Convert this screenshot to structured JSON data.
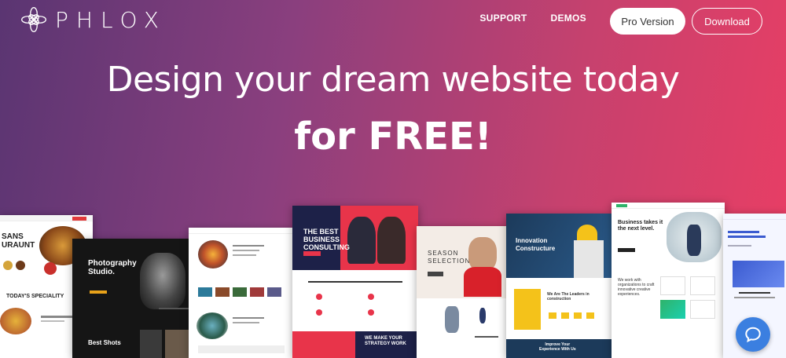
{
  "header": {
    "logo_text": "PHLOX",
    "nav": [
      "SUPPORT",
      "DEMOS"
    ],
    "pro_button": "Pro Version",
    "download_button": "Download"
  },
  "hero": {
    "line1": "Design your dream website today",
    "line2": "for FREE!"
  },
  "showcase": {
    "restaurant": {
      "title": "SANS\nURAUNT",
      "special": "TODAY'S SPECIALITY"
    },
    "photography": {
      "title": "Photography\nStudio.",
      "subtitle": "Best Shots"
    },
    "consulting": {
      "title": "THE BEST\nBUSINESS\nCONSULTING",
      "footer": "WE MAKE YOUR\nSTRATEGY WORK"
    },
    "fashion": {
      "title": "SEASON\nSELECTION"
    },
    "construction": {
      "title": "Innovation\nConstructure",
      "section": "We Are The Leaders in\nconstruction",
      "footer": "Improve Your\nExperience With Us"
    },
    "business": {
      "title": "Business takes it\nthe next level.",
      "body": "We work with\norganizations to craft\ninnovative creative\nexperiences."
    }
  },
  "chat_icon": "chat-bubble-icon",
  "colors": {
    "accent": "#ea3e64",
    "gradient_start": "#5a3572",
    "chat": "#3b7fe0"
  }
}
